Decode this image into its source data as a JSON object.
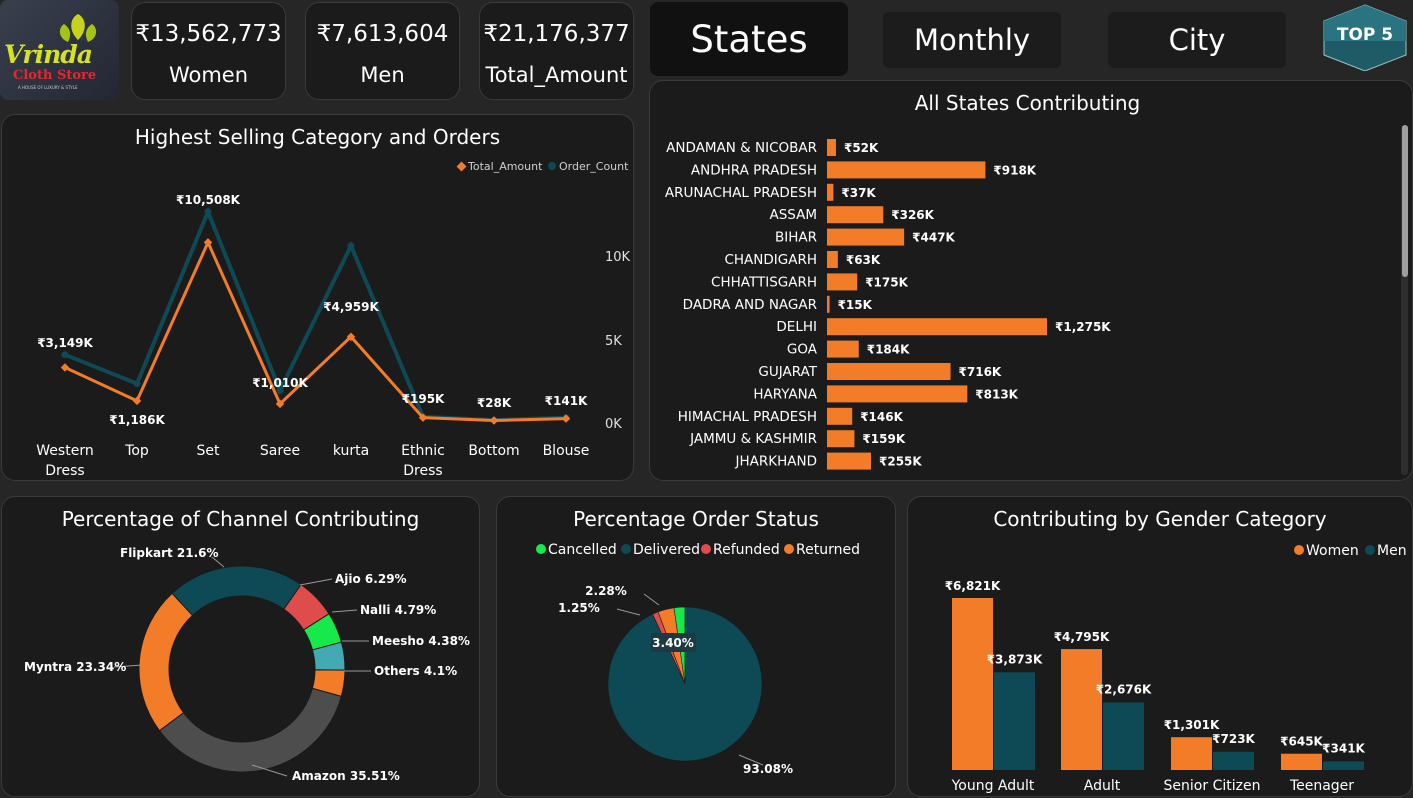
{
  "logo": {
    "line1": "Vrinda",
    "line2": "Cloth Store",
    "tagline": "A HOUSE OF LUXURY & STYLE"
  },
  "kpis": [
    {
      "value": "₹13,562,773",
      "label": "Women"
    },
    {
      "value": "₹7,613,604",
      "label": "Men"
    },
    {
      "value": "₹21,176,377",
      "label": "Total_Amount"
    }
  ],
  "nav": {
    "states": "States",
    "monthly": "Monthly",
    "city": "City",
    "top5": "TOP 5"
  },
  "colors": {
    "orange": "#f27c28",
    "teal": "#0e4a56",
    "gray": "#4d4d4d",
    "red": "#e04b4b",
    "green": "#16e94a",
    "cyan": "#43a9b4"
  },
  "category_chart": {
    "title": "Highest Selling Category and Orders",
    "legend": [
      "Total_Amount",
      "Order_Count"
    ],
    "y_ticks": [
      "10K",
      "5K",
      "0K"
    ],
    "chart_data": {
      "type": "line",
      "categories": [
        "Western Dress",
        "Top",
        "Set",
        "Saree",
        "kurta",
        "Ethnic Dress",
        "Bottom",
        "Blouse"
      ],
      "series": [
        {
          "name": "Total_Amount",
          "values": [
            3149,
            1186,
            10508,
            1010,
            4959,
            195,
            28,
            141
          ],
          "labels": [
            "₹3,149K",
            "₹1,186K",
            "₹10,508K",
            "₹1,010K",
            "₹4,959K",
            "₹195K",
            "₹28K",
            "₹141K"
          ]
        },
        {
          "name": "Order_Count",
          "values": [
            3900,
            2200,
            12300,
            1800,
            10300,
            250,
            50,
            200
          ]
        }
      ]
    }
  },
  "states_chart": {
    "title": "All States Contributing",
    "chart_data": {
      "type": "bar",
      "categories": [
        "ANDAMAN & NICOBAR",
        "ANDHRA PRADESH",
        "ARUNACHAL PRADESH",
        "ASSAM",
        "BIHAR",
        "CHANDIGARH",
        "CHHATTISGARH",
        "DADRA AND NAGAR",
        "DELHI",
        "GOA",
        "GUJARAT",
        "HARYANA",
        "HIMACHAL PRADESH",
        "JAMMU & KASHMIR",
        "JHARKHAND"
      ],
      "values": [
        52,
        918,
        37,
        326,
        447,
        63,
        175,
        15,
        1275,
        184,
        716,
        813,
        146,
        159,
        255
      ],
      "labels": [
        "₹52K",
        "₹918K",
        "₹37K",
        "₹326K",
        "₹447K",
        "₹63K",
        "₹175K",
        "₹15K",
        "₹1,275K",
        "₹184K",
        "₹716K",
        "₹813K",
        "₹146K",
        "₹159K",
        "₹255K"
      ]
    }
  },
  "channel_chart": {
    "title": "Percentage of Channel Contributing",
    "chart_data": {
      "type": "pie",
      "slices": [
        {
          "name": "Flipkart",
          "value": 21.6,
          "label": "Flipkart 21.6%",
          "color": "#0e4a56"
        },
        {
          "name": "Ajio",
          "value": 6.29,
          "label": "Ajio 6.29%",
          "color": "#e04b4b"
        },
        {
          "name": "Nalli",
          "value": 4.79,
          "label": "Nalli 4.79%",
          "color": "#16e94a"
        },
        {
          "name": "Meesho",
          "value": 4.38,
          "label": "Meesho 4.38%",
          "color": "#43a9b4"
        },
        {
          "name": "Others",
          "value": 4.1,
          "label": "Others 4.1%",
          "color": "#f27c28"
        },
        {
          "name": "Amazon",
          "value": 35.51,
          "label": "Amazon 35.51%",
          "color": "#4d4d4d"
        },
        {
          "name": "Myntra",
          "value": 23.34,
          "label": "Myntra 23.34%",
          "color": "#f27c28"
        }
      ]
    }
  },
  "status_chart": {
    "title": "Percentage Order Status",
    "legend": [
      {
        "name": "Cancelled",
        "color": "#16e94a"
      },
      {
        "name": "Delivered",
        "color": "#0e4a56"
      },
      {
        "name": "Refunded",
        "color": "#e04b4b"
      },
      {
        "name": "Returned",
        "color": "#f27c28"
      }
    ],
    "chart_data": {
      "type": "pie",
      "slices": [
        {
          "name": "Cancelled",
          "value": 2.28,
          "label": "2.28%",
          "color": "#16e94a"
        },
        {
          "name": "Delivered",
          "value": 93.08,
          "label": "93.08%",
          "color": "#0e4a56"
        },
        {
          "name": "Refunded",
          "value": 1.25,
          "label": "1.25%",
          "color": "#e04b4b"
        },
        {
          "name": "Returned",
          "value": 3.4,
          "label": "3.40%",
          "color": "#f27c28"
        }
      ]
    }
  },
  "gender_chart": {
    "title": "Contributing by Gender Category",
    "legend": [
      "Women",
      "Men"
    ],
    "chart_data": {
      "type": "bar",
      "categories": [
        "Young Adult",
        "Adult",
        "Senior Citizen",
        "Teenager"
      ],
      "series": [
        {
          "name": "Women",
          "values": [
            6821,
            4795,
            1301,
            645
          ],
          "labels": [
            "₹6,821K",
            "₹4,795K",
            "₹1,301K",
            "₹645K"
          ]
        },
        {
          "name": "Men",
          "values": [
            3873,
            2676,
            723,
            341
          ],
          "labels": [
            "₹3,873K",
            "₹2,676K",
            "₹723K",
            "₹341K"
          ]
        }
      ]
    }
  }
}
